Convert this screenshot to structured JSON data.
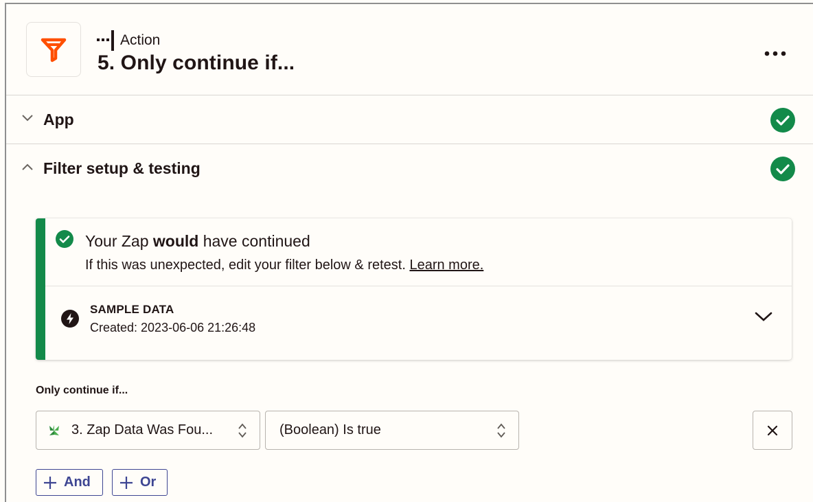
{
  "step": {
    "type_label": "Action",
    "title": "5. Only continue if..."
  },
  "sections": {
    "app": {
      "title": "App",
      "status": "complete"
    },
    "filter": {
      "title": "Filter setup & testing",
      "status": "complete"
    }
  },
  "result": {
    "title_pre": "Your Zap ",
    "title_bold": "would",
    "title_post": " have continued",
    "subtitle": "If this was unexpected, edit your filter below & retest. ",
    "learn_more": "Learn more."
  },
  "sample": {
    "title": "SAMPLE DATA",
    "created": "Created: 2023-06-06 21:26:48"
  },
  "filter": {
    "label": "Only continue if...",
    "field_value": "3. Zap Data Was Fou...",
    "operator_value": "(Boolean) Is true",
    "and_label": "And",
    "or_label": "Or"
  },
  "colors": {
    "brand_orange": "#ff4f00",
    "success_green": "#138a4a",
    "button_blue": "#3d4592"
  }
}
